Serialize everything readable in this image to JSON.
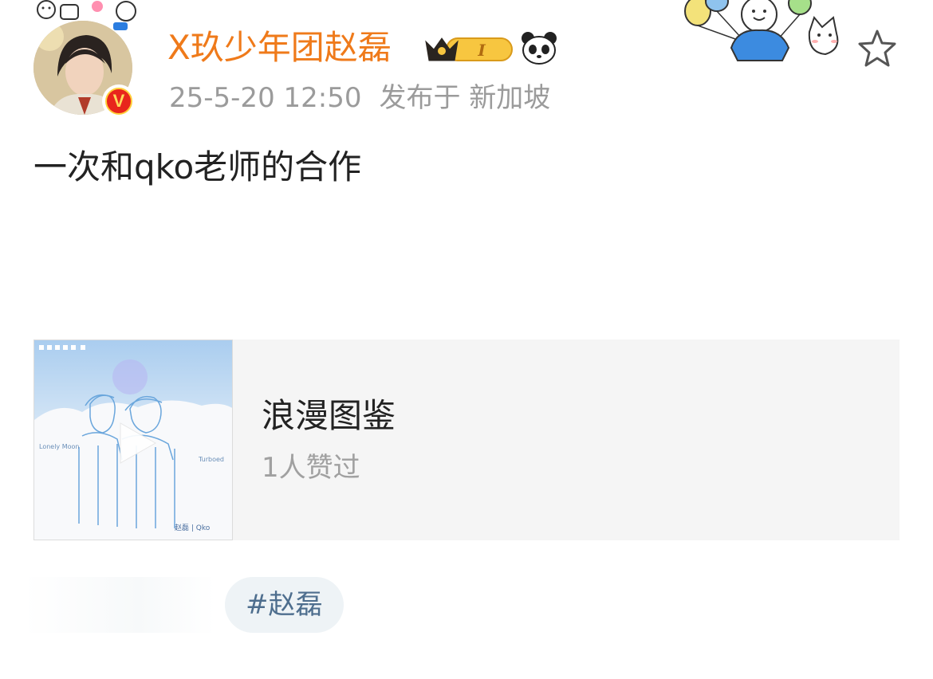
{
  "post": {
    "username": "X玖少年团赵磊",
    "vip_level": "I",
    "timestamp": "25-5-20 12:50",
    "location": "发布于 新加坡",
    "text": "一次和qko老师的合作"
  },
  "music_card": {
    "title": "浪漫图鉴",
    "likes": "1人赞过",
    "cover_text": {
      "left": "Lonely Moon",
      "right": "Turboed",
      "credit": "赵磊 | Qko"
    }
  },
  "topic": {
    "label": "#赵磊"
  },
  "colors": {
    "username": "#ef7a1a",
    "meta": "#9b9b9b",
    "tag_bg": "#eef3f6",
    "tag_text": "#4e6e8e",
    "verified": "#e8261c"
  },
  "icons": [
    "avatar",
    "verified-v-icon",
    "vip-crown-badge",
    "panda-icon",
    "star-favorite-icon",
    "play-icon"
  ]
}
